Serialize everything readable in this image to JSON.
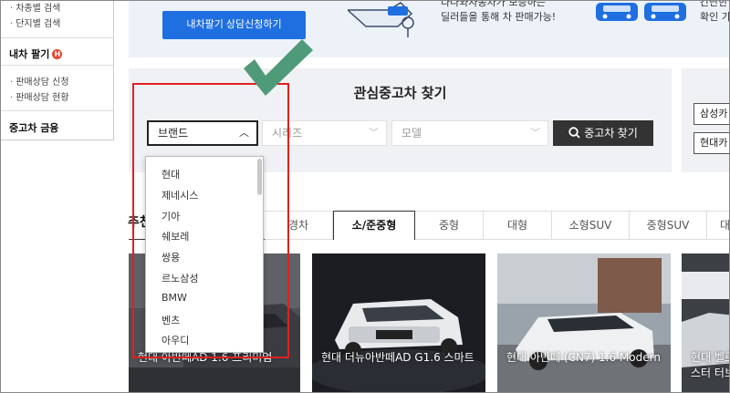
{
  "sidebar": {
    "items_top": [
      "차종별 검색",
      "단지별 검색"
    ],
    "sell_heading": "내차 팔기",
    "sell_badge": "H",
    "sell_items": [
      "판매상담 신청",
      "판매상담 현황"
    ],
    "finance": "중고차 금융"
  },
  "banner": {
    "apply_button": "내차팔기 상담신청하기",
    "text_line1": "다나와자동차가 보증하는",
    "text_line2": "딜러들을 통해 차 판매가능!",
    "right_line1": "간단한 정",
    "right_line2": "확인 가능"
  },
  "search": {
    "title": "관심중고차 찾기",
    "brand_label": "브랜드",
    "series_placeholder": "시리즈",
    "model_placeholder": "모델",
    "search_button": "중고차 찾기"
  },
  "right_panel": {
    "btn1": "삼성카",
    "btn2": "현대카"
  },
  "brand_options": [
    "현대",
    "제네시스",
    "기아",
    "쉐보레",
    "쌍용",
    "르노삼성",
    "BMW",
    "벤츠",
    "아우디"
  ],
  "recommend_label": "추천",
  "tabs": [
    "경차",
    "소/준중형",
    "중형",
    "대형",
    "소형SUV",
    "중형SUV",
    "대"
  ],
  "active_tab": "소/준중형",
  "cards": [
    {
      "caption": "현대 아반떼AD 1.6 프리미엄"
    },
    {
      "caption": "현대 더뉴아반떼AD G1.6 스마트"
    },
    {
      "caption": "현대 아반떼 (CN7) 1.6 Modern"
    },
    {
      "caption": "현대 벨로스터 터보"
    }
  ],
  "colors": {
    "primary_blue": "#1f6fe0",
    "highlight_red": "#e02020",
    "check_green": "#4f9a78"
  }
}
